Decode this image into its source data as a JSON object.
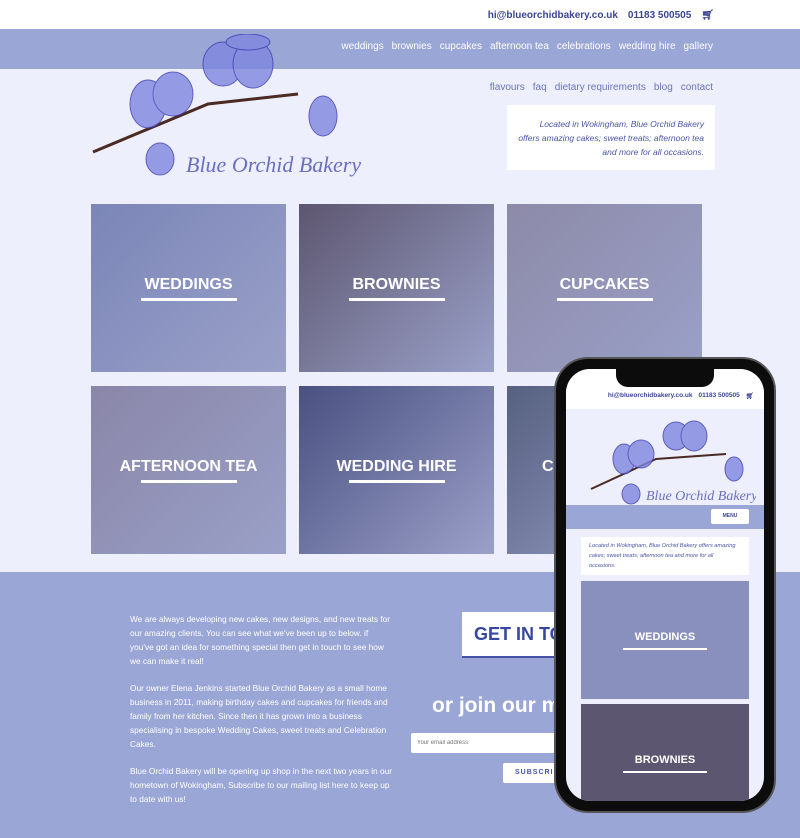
{
  "header": {
    "email": "hi@blueorchidbakery.co.uk",
    "phone": "01183 500505",
    "cart_icon": "cart-icon"
  },
  "nav": {
    "primary": [
      "weddings",
      "brownies",
      "cupcakes",
      "afternoon tea",
      "celebrations",
      "wedding hire",
      "gallery"
    ],
    "secondary": [
      "flavours",
      "faq",
      "dietary requirements",
      "blog",
      "contact"
    ]
  },
  "logo": {
    "text": "Blue Orchid Bakery"
  },
  "intro": "Located in Wokingham, Blue Orchid Bakery offers amazing cakes; sweet treats; afternoon tea and more for all occasions.",
  "tiles": [
    {
      "label": "WEDDINGS",
      "color": "#7b86b8"
    },
    {
      "label": "BROWNIES",
      "color": "#5d5670"
    },
    {
      "label": "CUPCAKES",
      "color": "#8d8aa8"
    },
    {
      "label": "AFTERNOON TEA",
      "color": "#8a86a8"
    },
    {
      "label": "WEDDING HIRE",
      "color": "#4a5080"
    },
    {
      "label": "CELEBRATIONS",
      "color": "#566080"
    }
  ],
  "about": [
    "We are always developing new cakes, new designs, and new treats for our amazing clients. You can see what we've been up to below. if you've got an idea for something special then get in touch to see how we can make it real!",
    "Our owner Elena Jenkins started Blue Orchid Bakery as a small home business in 2011, making birthday cakes and cupcakes for friends and family from her kitchen. Since then it has grown into a business specialising in bespoke Wedding Cakes, sweet treats and Celebration Cakes.",
    "Blue Orchid Bakery will be opening up shop in the next two years in our hometown of Wokingham, Subscribe to our mailing list here to keep up to date with us!"
  ],
  "cta": {
    "button": "GET IN TOUCH",
    "join": "or join our mailing list",
    "email_placeholder": "Your email address",
    "subscribe": "SUBSCRIBE"
  },
  "mobile": {
    "menu": "MENU",
    "tiles": [
      "WEDDINGS",
      "BROWNIES"
    ]
  }
}
